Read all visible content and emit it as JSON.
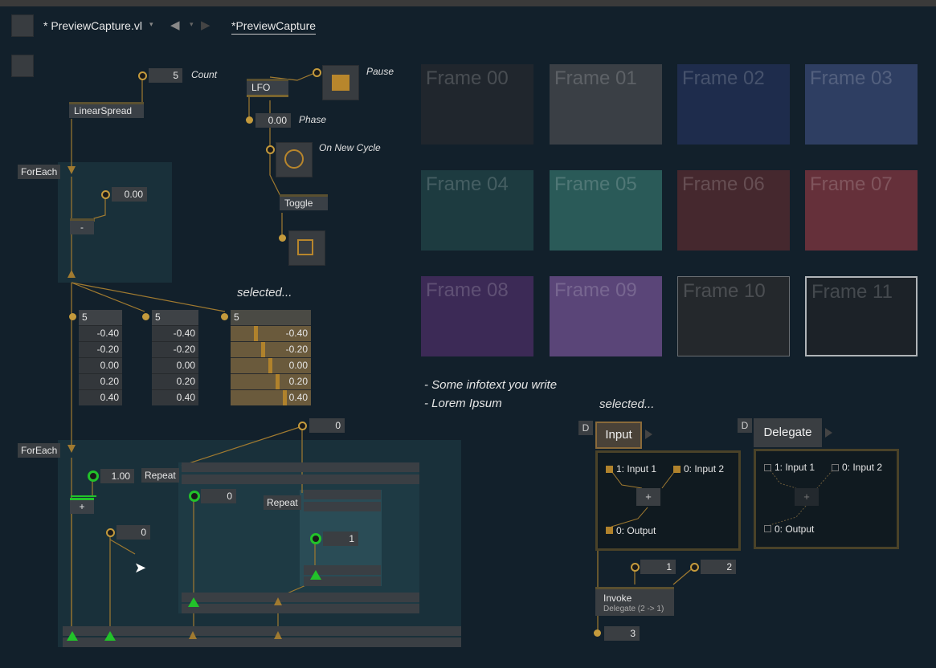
{
  "toolbar": {
    "doc_tab": "* PreviewCapture.vl",
    "patch_tab": "*PreviewCapture"
  },
  "nodes": {
    "count_value": "5",
    "count_label": "Count",
    "linearspread": "LinearSpread",
    "lfo": "LFO",
    "pause_label": "Pause",
    "phase_value": "0.00",
    "phase_label": "Phase",
    "on_new_cycle_label": "On New Cycle",
    "toggle": "Toggle",
    "foreach1": "ForEach",
    "foreach1_input": "0.00",
    "minus": "-",
    "selected1": "selected...",
    "foreach2": "ForEach",
    "plus_input": "1.00",
    "plus": "+",
    "zero_a": "0",
    "repeat1": "Repeat",
    "repeat1_input": "0",
    "repeat2": "Repeat",
    "repeat2_input": "1",
    "top_zero": "0"
  },
  "spreads": [
    {
      "count": "5",
      "values": [
        "-0.40",
        "-0.20",
        "0.00",
        "0.20",
        "0.40"
      ]
    },
    {
      "count": "5",
      "values": [
        "-0.40",
        "-0.20",
        "0.00",
        "0.20",
        "0.40"
      ]
    },
    {
      "count": "5",
      "values": [
        "-0.40",
        "-0.20",
        "0.00",
        "0.20",
        "0.40"
      ]
    }
  ],
  "frames": [
    {
      "label": "Frame 00",
      "color": "#20262d"
    },
    {
      "label": "Frame 01",
      "color": "#3a3f45"
    },
    {
      "label": "Frame 02",
      "color": "#1e2c4c"
    },
    {
      "label": "Frame 03",
      "color": "#2e3e62"
    },
    {
      "label": "Frame 04",
      "color": "#1d3b40"
    },
    {
      "label": "Frame 05",
      "color": "#2a5a58"
    },
    {
      "label": "Frame 06",
      "color": "#45282e"
    },
    {
      "label": "Frame 07",
      "color": "#65303a"
    },
    {
      "label": "Frame 08",
      "color": "#3c2a56"
    },
    {
      "label": "Frame 09",
      "color": "#5a4578"
    },
    {
      "label": "Frame 10",
      "color": "#24282c"
    },
    {
      "label": "Frame 11",
      "color": "#1c2228"
    }
  ],
  "info": {
    "line1": "- Some infotext you write",
    "line2": "- Lorem Ipsum",
    "selected2": "selected..."
  },
  "input_patch": {
    "d": "D",
    "title": "Input",
    "in1": "1: Input 1",
    "in2": "0: Input 2",
    "op": "+",
    "out": "0: Output"
  },
  "delegate_patch": {
    "d": "D",
    "title": "Delegate",
    "in1": "1: Input 1",
    "in2": "0: Input 2",
    "op": "+",
    "out": "0: Output"
  },
  "invoke": {
    "arg1": "1",
    "arg2": "2",
    "title": "Invoke",
    "subtitle": "Delegate (2 -> 1)",
    "result": "3"
  }
}
